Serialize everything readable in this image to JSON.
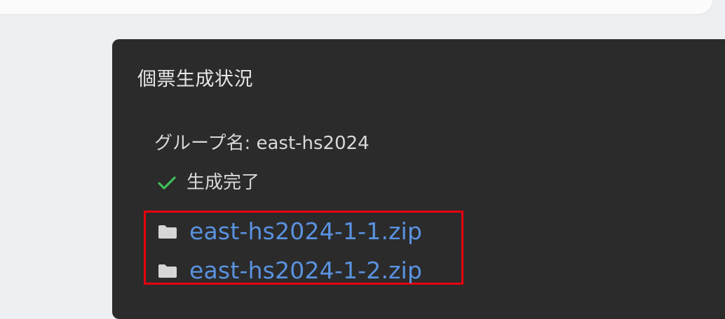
{
  "panel": {
    "title": "個票生成状況",
    "group_label": "グループ名: east-hs2024",
    "status_text": "生成完了",
    "status_icon": "check-icon",
    "status_color": "#3fbf5a"
  },
  "files": [
    {
      "name": "east-hs2024-1-1.zip",
      "icon": "folder-icon"
    },
    {
      "name": "east-hs2024-1-2.zip",
      "icon": "folder-icon"
    }
  ],
  "colors": {
    "panel_background": "#2b2b2b",
    "link": "#5a92e0",
    "highlight_border": "#e8000f",
    "page_background": "#edf0f3"
  }
}
